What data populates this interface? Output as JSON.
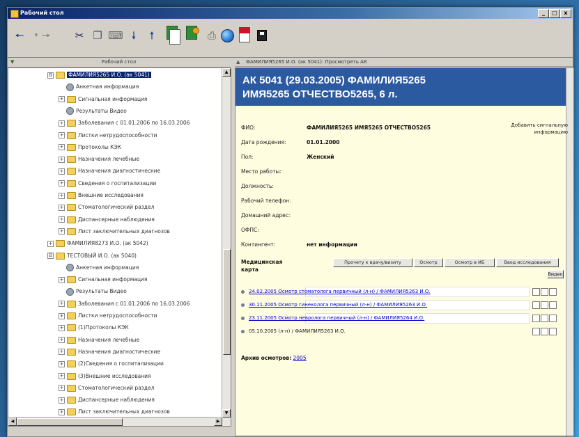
{
  "window": {
    "title": "Рабочий стол"
  },
  "title_buttons": {
    "minimize": "_",
    "maximize": "□",
    "close": "x"
  },
  "toolbar": {
    "icons": [
      "arrow-back-icon",
      "arrow-forward-icon",
      "scissors-icon",
      "copy-icon",
      "paste-icon",
      "arrow-down-icon",
      "arrow-up-icon",
      "documents-icon",
      "export-icon",
      "print-icon",
      "globe-icon",
      "red-document-icon",
      "black-box-icon"
    ]
  },
  "left_pane": {
    "header": "Рабочий стол",
    "tree": [
      {
        "label": "ФАМИЛИЯ5265 И.О. (ак 5041)",
        "type": "folder",
        "expander": "⊟",
        "selected": true,
        "indent": 0
      },
      {
        "label": "Анкетная информация",
        "type": "gear",
        "indent": 1
      },
      {
        "label": "Сигнальная информация",
        "type": "folder",
        "expander": "+",
        "indent": 1
      },
      {
        "label": "Результаты Видео",
        "type": "gear",
        "indent": 1
      },
      {
        "label": "Заболевания с 01.01.2006 по 16.03.2006",
        "type": "folder",
        "expander": "+",
        "indent": 1
      },
      {
        "label": "Листки нетрудоспособности",
        "type": "folder",
        "expander": "+",
        "indent": 1
      },
      {
        "label": "Протоколы КЭК",
        "type": "folder",
        "expander": "+",
        "indent": 1
      },
      {
        "label": "Назначения лечебные",
        "type": "folder",
        "expander": "+",
        "indent": 1
      },
      {
        "label": "Назначения диагностические",
        "type": "folder",
        "expander": "+",
        "indent": 1
      },
      {
        "label": "Сведения о госпитализации",
        "type": "folder",
        "expander": "+",
        "indent": 1
      },
      {
        "label": "Внешние исследования",
        "type": "folder",
        "expander": "+",
        "indent": 1
      },
      {
        "label": "Стоматологический раздел",
        "type": "folder",
        "expander": "+",
        "indent": 1
      },
      {
        "label": "Диспансерные наблюдения",
        "type": "folder",
        "expander": "+",
        "indent": 1
      },
      {
        "label": "Лист заключительных диагнозов",
        "type": "folder",
        "expander": "+",
        "indent": 1
      },
      {
        "label": "ФАМИЛИЯ8273 И.О. (ак 5042)",
        "type": "folder",
        "expander": "+",
        "indent": 0
      },
      {
        "label": "ТЕСТОВЫЙ И.О. (ак 5040)",
        "type": "folder",
        "expander": "⊟",
        "indent": 0
      },
      {
        "label": "Анкетная информация",
        "type": "gear",
        "indent": 1
      },
      {
        "label": "Сигнальная информация",
        "type": "folder",
        "expander": "+",
        "indent": 1
      },
      {
        "label": "Результаты Видео",
        "type": "gear",
        "indent": 1
      },
      {
        "label": "Заболевания с 01.01.2006 по 16.03.2006",
        "type": "folder",
        "expander": "+",
        "indent": 1
      },
      {
        "label": "Листки нетрудоспособности",
        "type": "folder",
        "expander": "+",
        "indent": 1
      },
      {
        "label": "(1)Протоколы КЭК",
        "type": "folder",
        "expander": "+",
        "indent": 1
      },
      {
        "label": "Назначения лечебные",
        "type": "folder",
        "expander": "+",
        "indent": 1
      },
      {
        "label": "Назначения диагностические",
        "type": "folder",
        "expander": "+",
        "indent": 1
      },
      {
        "label": "(2)Сведения о госпитализации",
        "type": "folder",
        "expander": "+",
        "indent": 1
      },
      {
        "label": "(3)Внешние исследования",
        "type": "folder",
        "expander": "+",
        "indent": 1
      },
      {
        "label": "Стоматологический раздел",
        "type": "folder",
        "expander": "+",
        "indent": 1
      },
      {
        "label": "Диспансерные наблюдения",
        "type": "folder",
        "expander": "+",
        "indent": 1
      },
      {
        "label": "Лист заключительных диагнозов",
        "type": "folder",
        "expander": "+",
        "indent": 1
      }
    ]
  },
  "right_pane": {
    "breadcrumb": "ФАМИЛИЯ5265 И.О. (ак 5041): Просмотреть АК",
    "header_line1": "АК 5041 (29.03.2005) ФАМИЛИЯ5265",
    "header_line2": "ИМЯ5265 ОТЧЕСТВО5265, 6 л.",
    "add_info": "Добавить сигнальную информацию",
    "fields": [
      {
        "label": "ФИО:",
        "value": "ФАМИЛИЯ5265 ИМЯ5265 ОТЧЕСТВО5265"
      },
      {
        "label": "Дата рождения:",
        "value": "01.01.2000"
      },
      {
        "label": "Пол:",
        "value": "Женский"
      },
      {
        "label": "Место работы:",
        "value": ""
      },
      {
        "label": "Должность:",
        "value": ""
      },
      {
        "label": "Рабочий телефон:",
        "value": ""
      },
      {
        "label": "Домашний адрес:",
        "value": ""
      },
      {
        "label": "ОФПС:",
        "value": ""
      },
      {
        "label": "Контингент:",
        "value": "нет информации"
      }
    ],
    "medcard_label": "Медицинская карта",
    "medcard_buttons": [
      "Прочету к врачу/визиту",
      "Осмотр",
      "Осмотр в ИБ",
      "Ввод исследования"
    ],
    "video_button": "Видео",
    "records": [
      {
        "text": "24.02.2005 Осмотр стоматолога первичный (л-н) / ФАМИЛИЯ5263 И.О.",
        "link": true
      },
      {
        "text": "30.11.2005 Осмотр гинеколога первичный (л-н) / ФАМИЛИЯ5263 И.О.",
        "link": true
      },
      {
        "text": "23.11.2005 Осмотр невролога первичный (л-н) / ФАМИЛИЯ5264 И.О.",
        "link": true
      },
      {
        "text": "05.10.2005 (л-н) / ФАМИЛИЯ5263 И.О.",
        "link": false
      }
    ],
    "archive_label": "Архив осмотров:",
    "archive_year": "2005"
  }
}
